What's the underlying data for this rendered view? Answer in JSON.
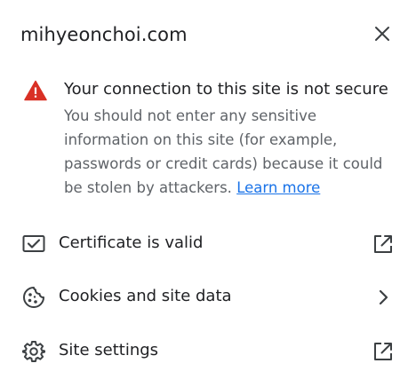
{
  "header": {
    "site": "mihyeonchoi.com",
    "close_icon": "close-icon"
  },
  "warning": {
    "icon": "warning-triangle-icon",
    "icon_color": "#d93025",
    "title": "Your connection to this site is not secure",
    "body": "You should not enter any sensitive information on this site (for example, passwords or credit cards) because it could be stolen by attackers.",
    "link_label": "Learn more",
    "link_color": "#1a73e8"
  },
  "rows": [
    {
      "label": "Certificate is valid",
      "icon": "certificate-icon",
      "trailing_icon": "open-in-new-icon"
    },
    {
      "label": "Cookies and site data",
      "icon": "cookie-icon",
      "trailing_icon": "chevron-right-icon"
    },
    {
      "label": "Site settings",
      "icon": "gear-icon",
      "trailing_icon": "open-in-new-icon"
    }
  ]
}
